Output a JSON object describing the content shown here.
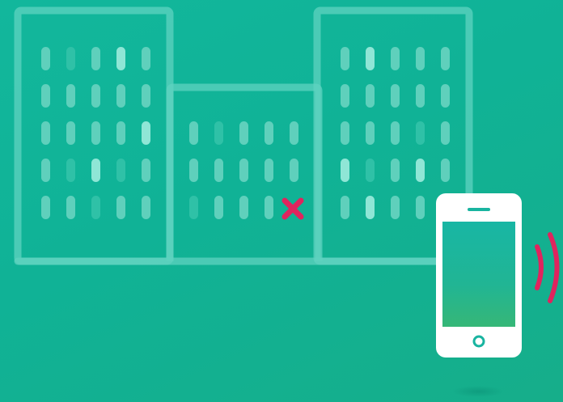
{
  "scene": {
    "description_colors": {
      "background_top": "#12b79c",
      "background_bottom": "#16ae8a",
      "outline": "#5fd3c0",
      "window_light": "#8fe6d6",
      "window_mid": "#5fd0bc",
      "window_dim": "#2fc1a7",
      "window_faint": "#23b89c",
      "alert": "#e0245e",
      "phone_body": "#ffffff",
      "phone_screen_top": "#18b6a4",
      "phone_screen_bottom": "#32b578"
    },
    "icons": {
      "left_building": "office-building-icon",
      "middle_building": "office-building-icon",
      "right_building": "office-building-icon",
      "marker": "x-mark-icon",
      "device": "smartphone-icon",
      "signal": "wireless-signal-icon"
    },
    "window_levels": {
      "left_building": [
        [
          "mid",
          "dim",
          "mid",
          "light",
          "mid"
        ],
        [
          "mid",
          "mid",
          "mid",
          "mid",
          "mid"
        ],
        [
          "mid",
          "mid",
          "mid",
          "mid",
          "light"
        ],
        [
          "mid",
          "dim",
          "light",
          "dim",
          "mid"
        ],
        [
          "mid",
          "mid",
          "dim",
          "mid",
          "mid"
        ]
      ],
      "middle_building": [
        [
          "mid",
          "dim",
          "mid",
          "mid",
          "mid"
        ],
        [
          "mid",
          "mid",
          "mid",
          "mid",
          "mid"
        ],
        [
          "dim",
          "mid",
          "mid",
          "mid",
          "x"
        ]
      ],
      "right_building": [
        [
          "mid",
          "light",
          "mid",
          "mid",
          "mid"
        ],
        [
          "mid",
          "mid",
          "mid",
          "mid",
          "mid"
        ],
        [
          "mid",
          "mid",
          "mid",
          "dim",
          "mid"
        ],
        [
          "light",
          "dim",
          "mid",
          "light",
          "mid"
        ],
        [
          "mid",
          "light",
          "mid",
          "mid",
          "mid"
        ]
      ]
    }
  }
}
